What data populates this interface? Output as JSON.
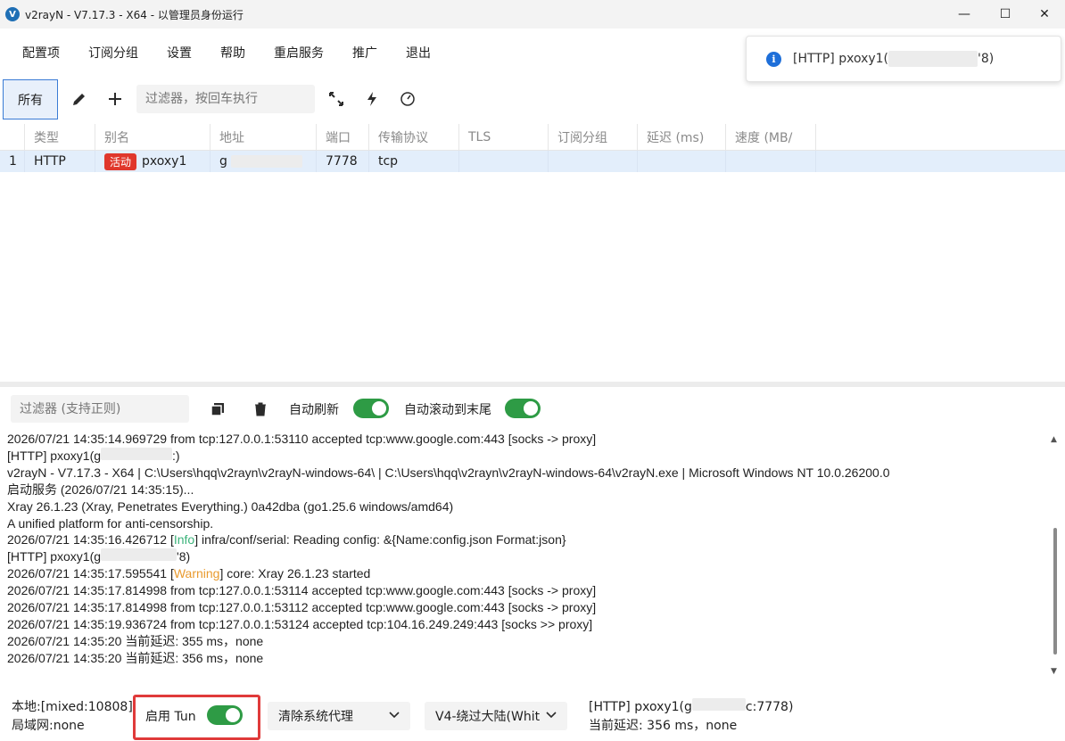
{
  "window": {
    "title": "v2rayN - V7.17.3 - X64 - 以管理员身份运行",
    "logo_letter": "V",
    "min": "—",
    "max": "☐",
    "close": "✕"
  },
  "menu": [
    "配置项",
    "订阅分组",
    "设置",
    "帮助",
    "重启服务",
    "推广",
    "退出"
  ],
  "toast": {
    "icon": "info-icon",
    "prefix": "[HTTP] pxoxy1(",
    "suffix": "'8)"
  },
  "toolbar": {
    "all_label": "所有",
    "filter_placeholder": "过滤器，按回车执行",
    "icons": [
      "edit-icon",
      "add-icon",
      "expand-icon",
      "lightning-icon",
      "speedometer-icon"
    ]
  },
  "table": {
    "headers": [
      "类型",
      "别名",
      "地址",
      "端口",
      "传输协议",
      "TLS",
      "订阅分组",
      "延迟 (ms)",
      "速度 (MB/"
    ],
    "rows": [
      {
        "index": "1",
        "type": "HTTP",
        "badge": "活动",
        "alias": "pxoxy1",
        "address_prefix": "g",
        "port": "7778",
        "network": "tcp"
      }
    ]
  },
  "log_toolbar": {
    "filter_placeholder": "过滤器 (支持正则)",
    "auto_refresh_label": "自动刷新",
    "auto_refresh_on": true,
    "auto_scroll_label": "自动滚动到末尾",
    "auto_scroll_on": true
  },
  "log_lines": [
    {
      "text": "2026/07/21 14:35:14.969729 from tcp:127.0.0.1:53110 accepted tcp:www.google.com:443 [socks -> proxy]"
    },
    {
      "pre": "[HTTP] pxoxy1(g",
      "post": ":)"
    },
    {
      "text": "v2rayN - V7.17.3 - X64 | C:\\Users\\hqq\\v2rayn\\v2rayN-windows-64\\ | C:\\Users\\hqq\\v2rayn\\v2rayN-windows-64\\v2rayN.exe | Microsoft Windows NT 10.0.26200.0"
    },
    {
      "text": "启动服务 (2026/07/21 14:35:15)..."
    },
    {
      "text": "Xray 26.1.23 (Xray, Penetrates Everything.) 0a42dba (go1.25.6 windows/amd64)"
    },
    {
      "text": "A unified platform for anti-censorship."
    },
    {
      "pre": "2026/07/21 14:35:16.426712 [",
      "level": "Info",
      "level_class": "lvl-info",
      "post": "] infra/conf/serial: Reading config: &{Name:config.json Format:json}"
    },
    {
      "pre": "[HTTP] pxoxy1(g",
      "post": "'8)"
    },
    {
      "pre": "2026/07/21 14:35:17.595541 [",
      "level": "Warning",
      "level_class": "lvl-warn",
      "post": "] core: Xray 26.1.23 started"
    },
    {
      "text": "2026/07/21 14:35:17.814998 from tcp:127.0.0.1:53114 accepted tcp:www.google.com:443 [socks -> proxy]"
    },
    {
      "text": "2026/07/21 14:35:17.814998 from tcp:127.0.0.1:53112 accepted tcp:www.google.com:443 [socks -> proxy]"
    },
    {
      "text": "2026/07/21 14:35:19.936724 from tcp:127.0.0.1:53124 accepted tcp:104.16.249.249:443 [socks >> proxy]"
    },
    {
      "text": "2026/07/21 14:35:20 当前延迟: 355 ms，none"
    },
    {
      "text": "2026/07/21 14:35:20 当前延迟: 356 ms，none"
    }
  ],
  "status": {
    "local": "本地:[mixed:10808]",
    "lan": "局域网:none",
    "tun_label": "启用 Tun",
    "tun_on": true,
    "system_proxy": "清除系统代理",
    "routing": "V4-绕过大陆(Whit",
    "server_pre": "[HTTP] pxoxy1(g",
    "server_post": "c:7778)",
    "delay": "当前延迟: 356 ms，none"
  },
  "colors": {
    "accent": "#3a7bd5",
    "toggle_on": "#2e9b45",
    "badge_red": "#e0372b",
    "highlight_border": "#e03a3a",
    "info_level": "#3bb37a",
    "warning_level": "#e99a2e"
  }
}
